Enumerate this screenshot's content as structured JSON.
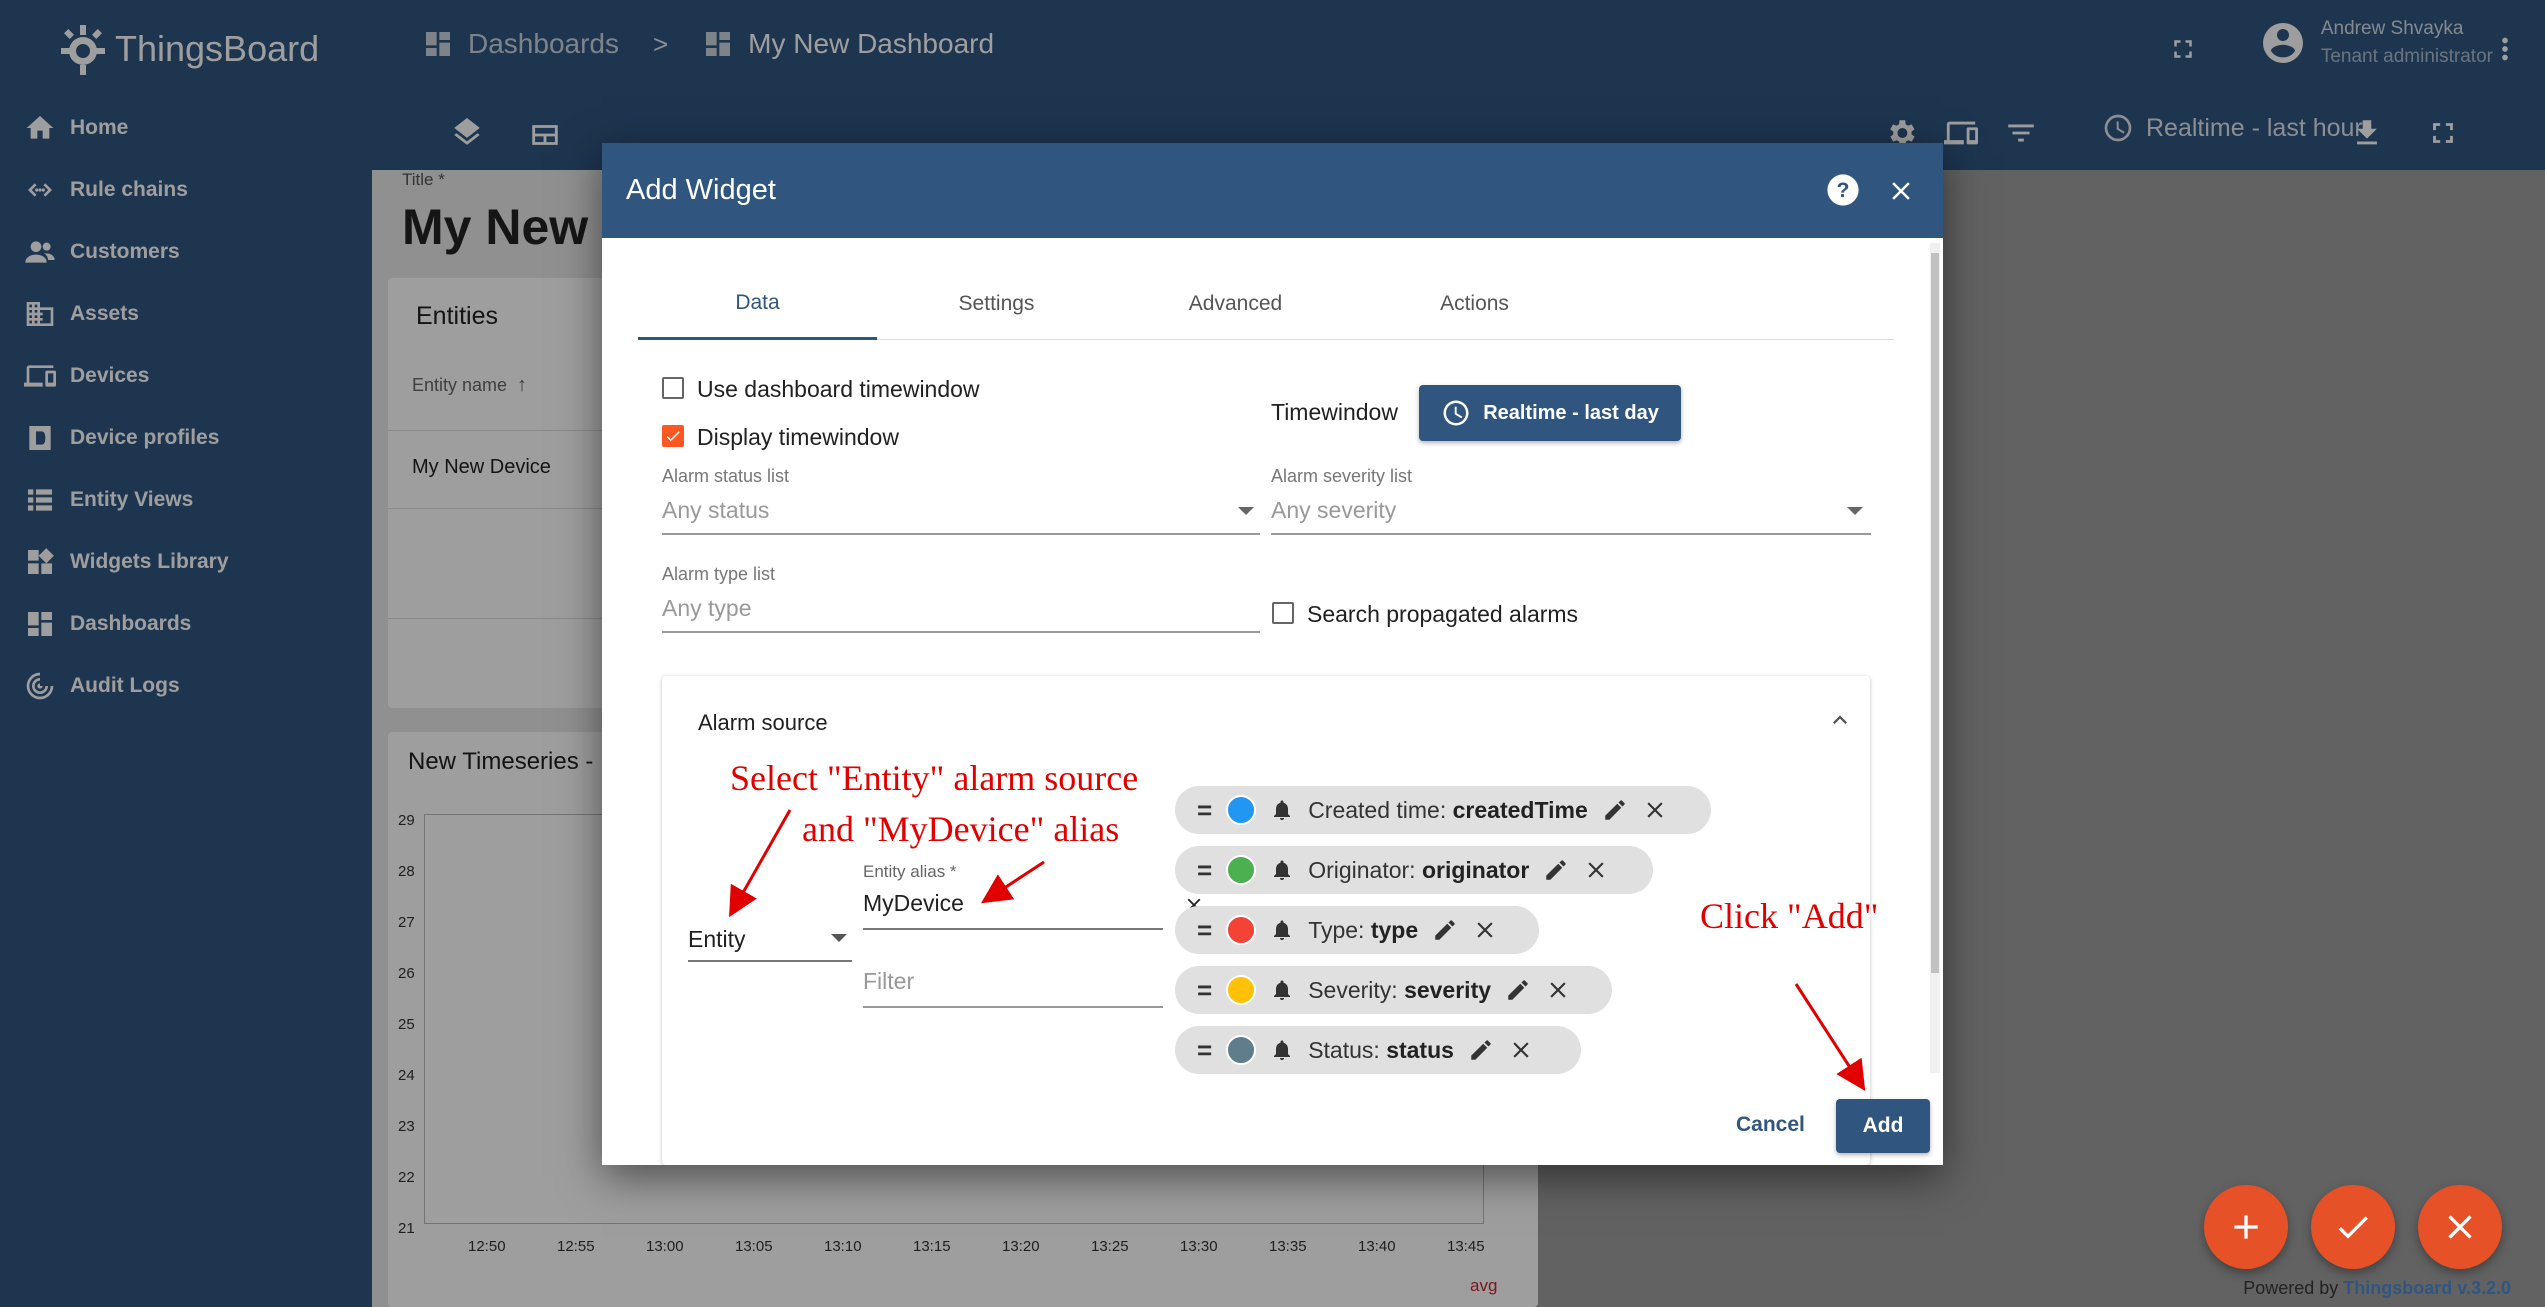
{
  "app": {
    "name": "ThingsBoard"
  },
  "sidebar": {
    "items": [
      {
        "label": "Home",
        "icon": "home-icon"
      },
      {
        "label": "Rule chains",
        "icon": "rule-chains-icon"
      },
      {
        "label": "Customers",
        "icon": "customers-icon"
      },
      {
        "label": "Assets",
        "icon": "assets-icon"
      },
      {
        "label": "Devices",
        "icon": "devices-icon"
      },
      {
        "label": "Device profiles",
        "icon": "device-profiles-icon"
      },
      {
        "label": "Entity Views",
        "icon": "entity-views-icon"
      },
      {
        "label": "Widgets Library",
        "icon": "widgets-library-icon"
      },
      {
        "label": "Dashboards",
        "icon": "dashboards-icon"
      },
      {
        "label": "Audit Logs",
        "icon": "audit-logs-icon"
      }
    ]
  },
  "header": {
    "breadcrumb": [
      "Dashboards",
      "My New Dashboard"
    ],
    "breadcrumb_sep": ">",
    "user_name": "Andrew Shvayka",
    "user_role": "Tenant administrator",
    "timewindow": "Realtime - last hour"
  },
  "dashboard": {
    "title_label": "Title *",
    "title": "My New D",
    "entities_card": {
      "title": "Entities",
      "col_header": "Entity name",
      "row": "My New Device"
    },
    "timeseries_card": {
      "title": "New Timeseries -",
      "y_ticks": [
        "29",
        "28",
        "27",
        "26",
        "25",
        "24",
        "23",
        "22",
        "21"
      ],
      "x_ticks": [
        "12:50",
        "12:55",
        "13:00",
        "13:05",
        "13:10",
        "13:15",
        "13:20",
        "13:25",
        "13:30",
        "13:35",
        "13:40",
        "13:45"
      ],
      "legend_avg": "avg"
    }
  },
  "dialog": {
    "title": "Add Widget",
    "tabs": [
      "Data",
      "Settings",
      "Advanced",
      "Actions"
    ],
    "use_dashboard_timewindow": "Use dashboard timewindow",
    "display_timewindow": "Display timewindow",
    "timewindow_label": "Timewindow",
    "timewindow_button": "Realtime - last day",
    "alarm_status_label": "Alarm status list",
    "alarm_status_placeholder": "Any status",
    "alarm_severity_label": "Alarm severity list",
    "alarm_severity_placeholder": "Any severity",
    "alarm_type_label": "Alarm type list",
    "alarm_type_placeholder": "Any type",
    "search_propagated": "Search propagated alarms",
    "alarm_source": {
      "title": "Alarm source",
      "type_value": "Entity",
      "alias_label": "Entity alias *",
      "alias_value": "MyDevice",
      "filter_placeholder": "Filter",
      "keys": [
        {
          "label": "Created time:",
          "key": "createdTime",
          "color": "#2196f3"
        },
        {
          "label": "Originator:",
          "key": "originator",
          "color": "#4caf50"
        },
        {
          "label": "Type:",
          "key": "type",
          "color": "#f44336"
        },
        {
          "label": "Severity:",
          "key": "severity",
          "color": "#ffc107"
        },
        {
          "label": "Status:",
          "key": "status",
          "color": "#607d8b"
        }
      ]
    },
    "cancel": "Cancel",
    "add": "Add"
  },
  "annotations": {
    "line1": "Select \"Entity\" alarm source",
    "line2": "and \"MyDevice\" alias",
    "click_add": "Click \"Add\""
  },
  "footer": {
    "powered": "Powered by",
    "version": "Thingsboard v.3.2.0"
  }
}
